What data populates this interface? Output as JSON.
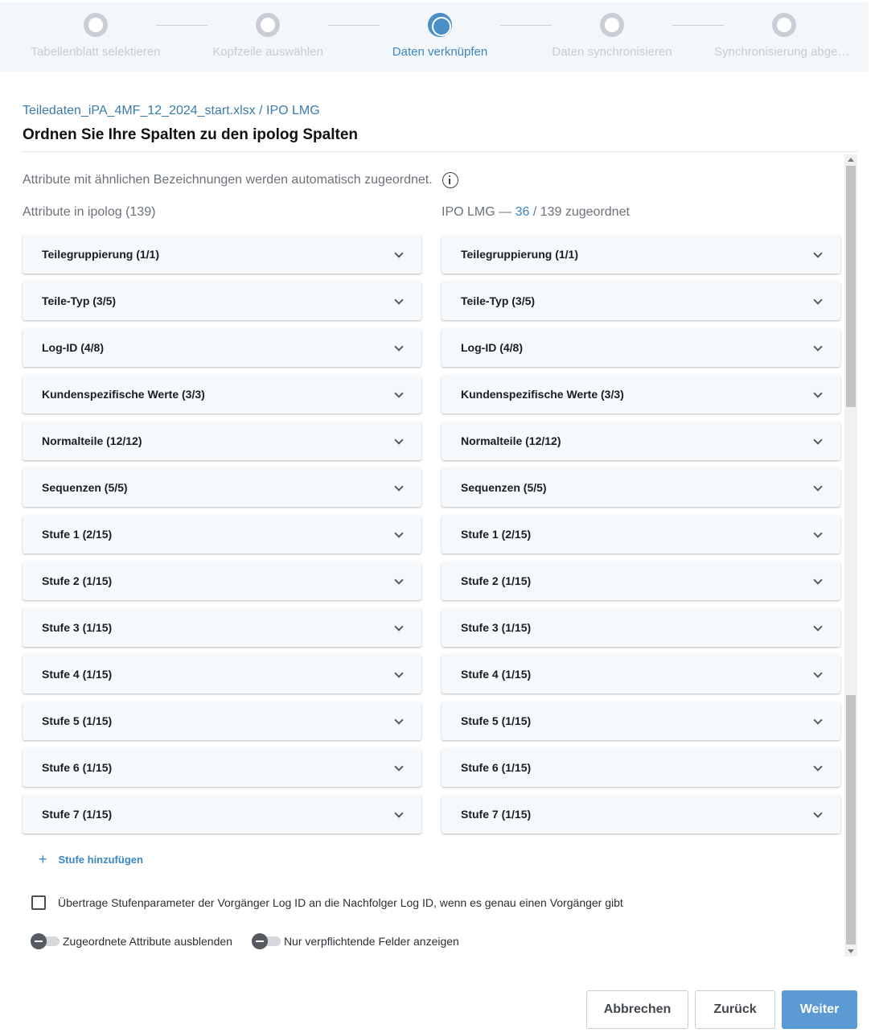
{
  "stepper": {
    "steps": [
      {
        "label": "Tabellenblatt selektieren",
        "state": "inactive"
      },
      {
        "label": "Kopfzeile auswählen",
        "state": "inactive"
      },
      {
        "label": "Daten verknüpfen",
        "state": "active"
      },
      {
        "label": "Daten synchronisieren",
        "state": "inactive"
      },
      {
        "label": "Synchronisierung abgeschlossen",
        "state": "inactive"
      }
    ]
  },
  "header": {
    "breadcrumb": "Teiledaten_iPA_4MF_12_2024_start.xlsx / IPO LMG",
    "title": "Ordnen Sie Ihre Spalten zu den ipolog Spalten"
  },
  "info_text": "Attribute mit ähnlichen Bezeichnungen werden automatisch zugeordnet.",
  "left_column": {
    "heading": "Attribute in ipolog (139)",
    "groups": [
      "Teilegruppierung (1/1)",
      "Teile-Typ (3/5)",
      "Log-ID (4/8)",
      "Kundenspezifische Werte (3/3)",
      "Normalteile (12/12)",
      "Sequenzen (5/5)",
      "Stufe 1 (2/15)",
      "Stufe 2 (1/15)",
      "Stufe 3 (1/15)",
      "Stufe 4 (1/15)",
      "Stufe 5 (1/15)",
      "Stufe 6 (1/15)",
      "Stufe 7 (1/15)"
    ]
  },
  "right_column": {
    "heading_prefix": "IPO LMG —",
    "heading_count": "36",
    "heading_suffix": "/ 139 zugeordnet",
    "groups": [
      "Teilegruppierung (1/1)",
      "Teile-Typ (3/5)",
      "Log-ID (4/8)",
      "Kundenspezifische Werte (3/3)",
      "Normalteile (12/12)",
      "Sequenzen (5/5)",
      "Stufe 1 (2/15)",
      "Stufe 2 (1/15)",
      "Stufe 3 (1/15)",
      "Stufe 4 (1/15)",
      "Stufe 5 (1/15)",
      "Stufe 6 (1/15)",
      "Stufe 7 (1/15)"
    ]
  },
  "add_stage": {
    "icon": "plus-icon",
    "label": "Stufe hinzufügen"
  },
  "options": {
    "transfer_checkbox": {
      "label": "Übertrage Stufenparameter der Vorgänger Log ID an die Nachfolger Log ID, wenn es genau einen Vorgänger gibt",
      "checked": false
    },
    "hide_assigned_toggle": {
      "label": "Zugeordnete Attribute ausblenden",
      "on": false
    },
    "required_only_toggle": {
      "label": "Nur verpflichtende Felder anzeigen",
      "on": false
    }
  },
  "footer": {
    "cancel_label": "Abbrechen",
    "back_label": "Zurück",
    "next_label": "Weiter"
  },
  "colors": {
    "accent": "#3a87c0",
    "primary_button": "#5b9ad2",
    "card_bg": "#f6f9fc",
    "stepper_bg": "#f4f7fa"
  }
}
